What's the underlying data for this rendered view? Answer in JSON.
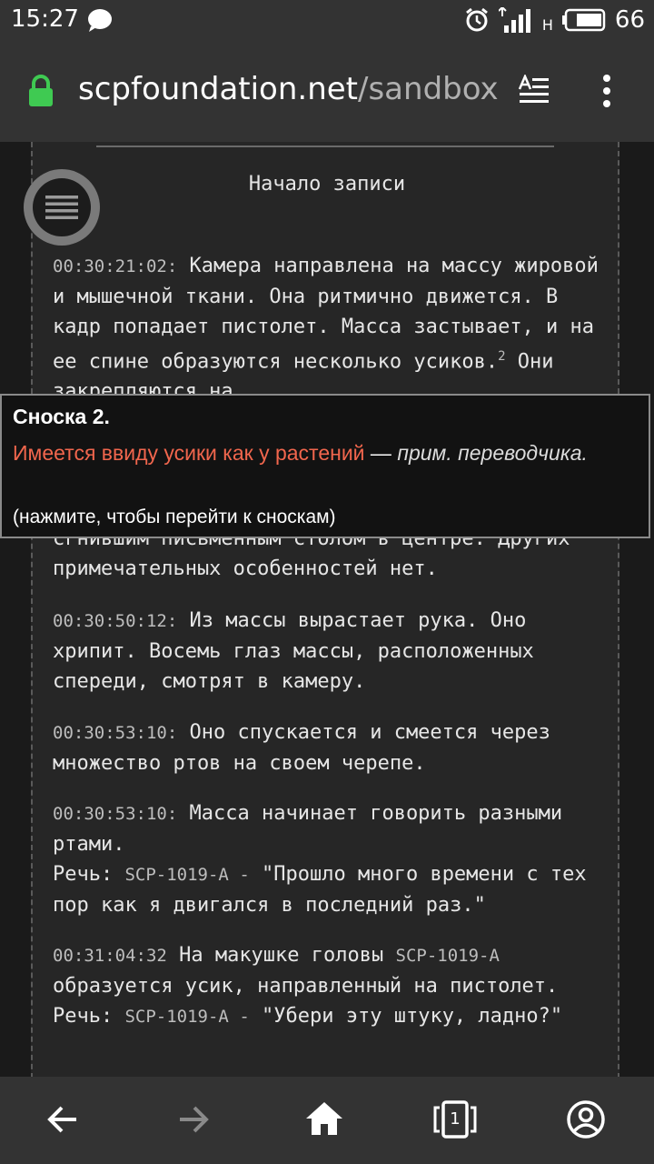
{
  "status": {
    "time": "15:27",
    "network": "H",
    "battery": "66",
    "icons": [
      "chat-icon",
      "alarm-icon",
      "signal-icon",
      "battery-icon"
    ]
  },
  "browser": {
    "domain": "scpfoundation.net",
    "path": "/sandbox"
  },
  "record": {
    "title": "Начало записи",
    "entries": [
      {
        "time": "00:30:21:02:",
        "text": " Камера направлена на массу жировой и мышечной ткани. Она ритмично движется. В кадр попадает пистолет. Масса застывает, и на ее спине образуются несколько усиков.",
        "footnote": "2",
        "after": " Они закрепляются на"
      },
      {
        "hidden_line": "сгнившим письменным столом в центре. Других примечательных особенностей нет."
      },
      {
        "time": "00:30:50:12:",
        "text": " Из массы вырастает рука. Оно хрипит. Восемь глаз массы, расположенных спереди, смотрят в камеру."
      },
      {
        "time": "00:30:53:10:",
        "text": " Оно спускается и смеется через множество ртов на своем черепе."
      },
      {
        "time": "00:30:53:10:",
        "text": " Масса начинает говорить разными ртами.",
        "speech_label": "Речь:",
        "speech_speaker": "SCP-1019-A -",
        "speech_text": " \"Прошло много времени с тех пор как я двигался в последний раз.\""
      },
      {
        "time": "00:31:04:32",
        "text": " На макушке головы ",
        "scp": "SCP-1019-A",
        "text2": " образуется усик, направленный на пистолет.",
        "speech_label": "Речь:",
        "speech_speaker": "SCP-1019-A -",
        "speech_text": " \"Убери эту штуку, ладно?\""
      }
    ]
  },
  "footnote_popup": {
    "title": "Сноска 2.",
    "body_red": "Имеется ввиду усики как у растений",
    "body_dash": " — ",
    "body_italic": "прим. переводчика.",
    "hint": "(нажмите, чтобы перейти к сноскам)"
  },
  "bottom_nav": {
    "tabs_count": "1"
  },
  "colors": {
    "accent_red": "#f1664d",
    "lock_green": "#3fca52"
  }
}
